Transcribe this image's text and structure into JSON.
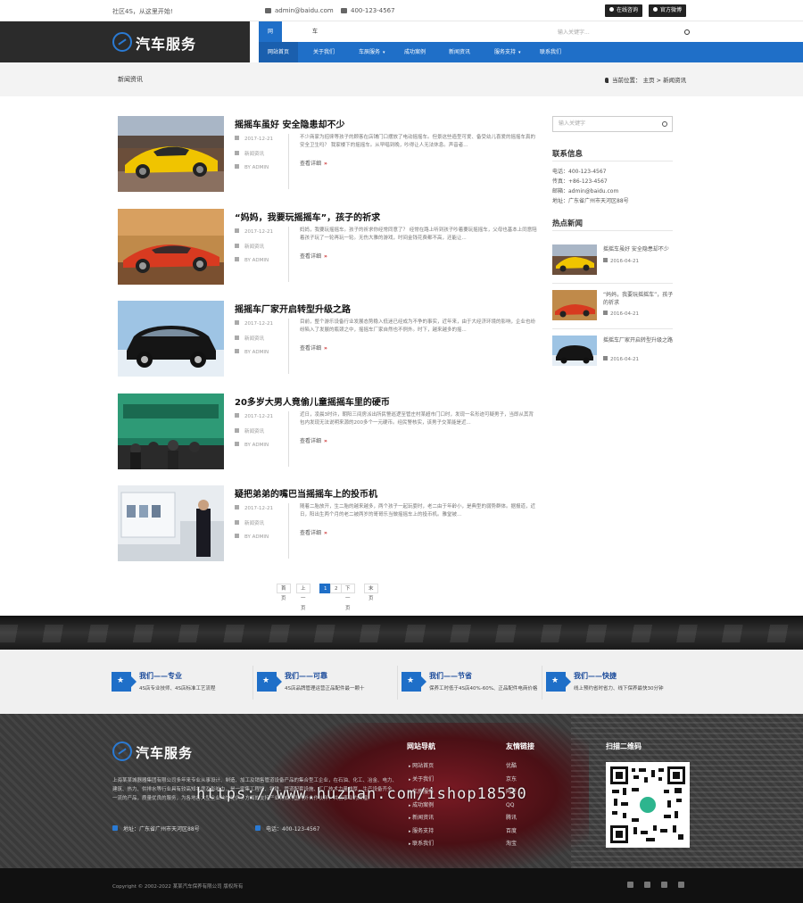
{
  "topbar": {
    "slogan": "社区4S，从这里开始!",
    "email": "admin@baidu.com",
    "phone": "400-123-4567",
    "btn_consult": "在线咨询",
    "btn_weibo": "官方微博"
  },
  "header": {
    "logo_text": "汽车服务",
    "subtabs": [
      "网站导航",
      "车房服务"
    ],
    "search_placeholder": "输入关键字...",
    "nav": [
      "网站首页",
      "关于我们",
      "车辰服务",
      "成功案例",
      "新闻资讯",
      "服务支持",
      "联系我们"
    ]
  },
  "breadcrumb": {
    "title": "新闻资讯",
    "location": "当前位置： 主页 > 新闻资讯"
  },
  "articles": [
    {
      "title": "摇摇车虽好 安全隐患却不少",
      "date": "2017-12-21",
      "category": "新闻资讯",
      "author": "BY ADMIN",
      "excerpt": "不少商家为招徕等孩子的顾客在店铺门口摆放了电动摇摇车。但景这些造型可爱、备受幼儿喜爱的摇摇车真的安全卫生吗？ 我家楼下的摇摇车。从早唱到晚，吵得让人无法休息。声音者...",
      "more": "查看详细"
    },
    {
      "title": "“妈妈，我要玩摇摇车”，孩子的祈求",
      "date": "2017-12-21",
      "category": "新闻资讯",
      "author": "BY ADMIN",
      "excerpt": "妈妈，我要玩摇摇车。孩子的祈求你经常同意了？ 经常在路上听到孩子吵着要玩摇摇车，父母也基本上同意陪着孩子玩了一轮再玩一轮。无伤大雅的游戏，时间金钱花费都不高，还能让...",
      "more": "查看详细"
    },
    {
      "title": "摇摇车厂家开启转型升级之路",
      "date": "2017-12-21",
      "category": "新闻资讯",
      "author": "BY ADMIN",
      "excerpt": "目前，整个游乐设备行业发展态势稳入低迷已经成为不争的事实，近年来，由于大经济环境的影响，企业也纷纷陷入了发展的瓶颈之中，摇摇车厂家自然也不例外。时下，越来越多的摇...",
      "more": "查看详细"
    },
    {
      "title": "20多岁大男人竟偷儿童摇摇车里的硬币",
      "date": "2017-12-21",
      "category": "新闻资讯",
      "author": "BY ADMIN",
      "excerpt": "近日，凌晨3时许，朝阳三间房派出所民警巡逻至管庄村某超市门口时，发现一名形迹可疑男子，当即从其背包内发现无法说明来源的200多个一元硬币。经民警核实，该男子交某能是近...",
      "more": "查看详细"
    },
    {
      "title": "疑把弟弟的嘴巴当摇摇车上的投币机",
      "date": "2017-12-21",
      "category": "新闻资讯",
      "author": "BY ADMIN",
      "excerpt": "随着二胎放开，生二胎的越来越多，两个孩子一起玩耍时，老二由于年龄小，是典型的弱势群体。据报道，近日，阳出生两个月的老二被两岁的哥哥乐当做摇摇车上的投币机。雅堂被...",
      "more": "查看详细"
    }
  ],
  "pagination": [
    "首页",
    "上一页",
    "1",
    "2",
    "下一页",
    "末页"
  ],
  "sidebar": {
    "search_placeholder": "输入关键字",
    "contact_title": "联系信息",
    "contact": [
      "电话：400-123-4567",
      "传真：+86-123-4567",
      "邮箱：admin@baidu.com",
      "地址：广东省广州市天河区88号"
    ],
    "hot_title": "热点新闻",
    "hot": [
      {
        "title": "摇摇车虽好 安全隐患却不少",
        "date": "2016-04-21"
      },
      {
        "title": "“妈妈，我要玩摇摇车”，孩子的祈求",
        "date": "2016-04-21"
      },
      {
        "title": "摇摇车厂家开启转型升级之路",
        "date": "2016-04-21"
      }
    ]
  },
  "features": [
    {
      "title": "我们——专业",
      "desc": "4S店专业技师、4S店标准工艺流程"
    },
    {
      "title": "我们——可靠",
      "desc": "4S店品牌管理运营正品配件最一颗十"
    },
    {
      "title": "我们——节省",
      "desc": "保养工时低于4S店40%-60%、正品配件电商价格"
    },
    {
      "title": "我们——快捷",
      "desc": "线上预约省时省力、线下保养最快30分钟"
    }
  ],
  "footer": {
    "logo_text": "汽车服务",
    "desc": "上海某某城器器集团有限公司多年来专业从事设计、制造、加工及销售管道设备产品的集合型工企业，在石油、化工、冶金、电力、建筑、热力、供排水等行业具有较高知名度及影响力，是一家集工程管、钢铁、管道配套设施、工厂技术力量雄厚，生产设备齐全，一流的产品，质量优良的服务，为各地各大型企业热忱提供多方面的支持产业将成为国内外合作伙伴，共创事业的辉煌。",
    "address": "地址：广东省广州市天河区88号",
    "phone": "电话：400-123-4567",
    "nav_title": "网站导航",
    "nav": [
      "网站首页",
      "关于我们",
      "车房服务",
      "成功案例",
      "新闻资讯",
      "服务支持",
      "联系我们"
    ],
    "links_title": "友情链接",
    "links": [
      "优酷",
      "京东",
      "阿里",
      "QQ",
      "腾讯",
      "百度",
      "淘宝"
    ],
    "qr_title": "扫描二维码",
    "watermark": "https://www.huzhan.com/ishop18530"
  },
  "copyright": "Copyright © 2002-2022 某某汽车保养有限公司 版权所有"
}
